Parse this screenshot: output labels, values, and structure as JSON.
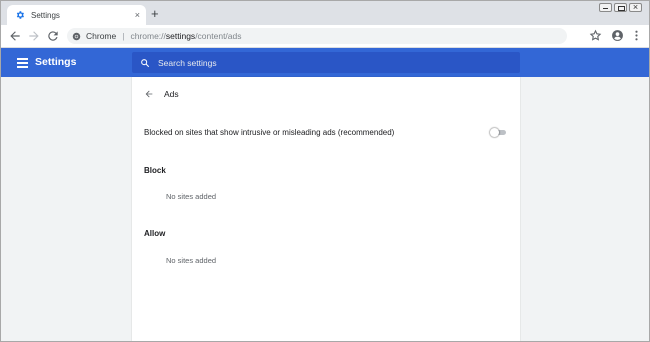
{
  "browser": {
    "tab_title": "Settings",
    "tab_close": "×",
    "new_tab": "+",
    "omnibox": {
      "chip": "Chrome",
      "separator": "|",
      "url_scheme": "chrome://",
      "url_host": "settings",
      "url_path": "/content/ads"
    },
    "icons": {
      "tab_favicon": "gear-icon",
      "back": "arrow-left-icon",
      "forward": "arrow-right-icon",
      "reload": "reload-icon",
      "site_info": "chrome-icon",
      "bookmark": "star-icon",
      "profile": "profile-icon",
      "menu": "more-vert-icon"
    }
  },
  "settings": {
    "app_title": "Settings",
    "search_placeholder": "Search settings",
    "page_title": "Ads",
    "toggle_label": "Blocked on sites that show intrusive or misleading ads (recommended)",
    "toggle_on": false,
    "sections": [
      {
        "title": "Block",
        "empty_text": "No sites added"
      },
      {
        "title": "Allow",
        "empty_text": "No sites added"
      }
    ]
  },
  "colors": {
    "header": "#3367d6",
    "search_bg": "#2a56c6",
    "accent_icon": "#1a73e8",
    "page_bg": "#f1f3f4"
  }
}
